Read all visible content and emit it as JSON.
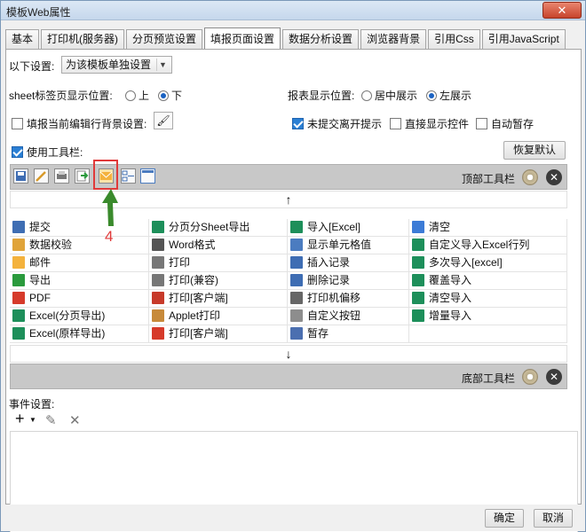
{
  "window": {
    "title": "模板Web属性",
    "close": "✕"
  },
  "tabs": [
    "基本",
    "打印机(服务器)",
    "分页预览设置",
    "填报页面设置",
    "数据分析设置",
    "浏览器背景",
    "引用Css",
    "引用JavaScript"
  ],
  "active_tab": "填报页面设置",
  "settings": {
    "apply_label": "以下设置:",
    "apply_value": "为该模板单独设置",
    "sheet_pos_label": "sheet标签页显示位置:",
    "sheet_pos_options": [
      "上",
      "下"
    ],
    "sheet_pos_selected": "下",
    "report_pos_label": "报表显示位置:",
    "report_pos_options": [
      "居中展示",
      "左展示"
    ],
    "report_pos_selected": "左展示",
    "fill_bg_label": "填报当前编辑行背景设置:",
    "unsubmitted_label": "未提交离开提示",
    "show_widget_label": "直接显示控件",
    "autosave_label": "自动暂存",
    "use_toolbar_label": "使用工具栏:",
    "restore_default": "恢复默认"
  },
  "top_toolbar": {
    "label": "顶部工具栏",
    "icons": [
      "save-icon",
      "validate-icon",
      "print-icon",
      "export-icon",
      "email-icon",
      "insert-record-icon",
      "blank-icon"
    ]
  },
  "bottom_toolbar": {
    "label": "底部工具栏"
  },
  "arrows": {
    "up": "↑",
    "down": "↓"
  },
  "callout": {
    "number": "4"
  },
  "buttons": [
    [
      {
        "label": "提交",
        "icon": "submit-icon"
      },
      {
        "label": "分页分Sheet导出",
        "icon": "excel-icon"
      },
      {
        "label": "导入[Excel]",
        "icon": "excel-import-icon"
      },
      {
        "label": "清空",
        "icon": "eraser-icon"
      }
    ],
    [
      {
        "label": "数据校验",
        "icon": "validate-icon"
      },
      {
        "label": "Word格式",
        "icon": "word-icon"
      },
      {
        "label": "显示单元格值",
        "icon": "cell-icon"
      },
      {
        "label": "自定义导入Excel行列",
        "icon": "excel-icon"
      }
    ],
    [
      {
        "label": "邮件",
        "icon": "email-icon"
      },
      {
        "label": "打印",
        "icon": "print-icon"
      },
      {
        "label": "插入记录",
        "icon": "insert-record-icon"
      },
      {
        "label": "多次导入[excel]",
        "icon": "excel-icon"
      }
    ],
    [
      {
        "label": "导出",
        "icon": "export-icon"
      },
      {
        "label": "打印(兼容)",
        "icon": "print-icon"
      },
      {
        "label": "删除记录",
        "icon": "delete-record-icon"
      },
      {
        "label": "覆盖导入",
        "icon": "excel-icon"
      }
    ],
    [
      {
        "label": "PDF",
        "icon": "pdf-icon"
      },
      {
        "label": "打印[客户端]",
        "icon": "flash-print-icon"
      },
      {
        "label": "打印机偏移",
        "icon": "move-icon"
      },
      {
        "label": "清空导入",
        "icon": "excel-icon"
      }
    ],
    [
      {
        "label": "Excel(分页导出)",
        "icon": "excel-icon"
      },
      {
        "label": "Applet打印",
        "icon": "applet-icon"
      },
      {
        "label": "自定义按钮",
        "icon": "gear-icon"
      },
      {
        "label": "增量导入",
        "icon": "excel-icon"
      }
    ],
    [
      {
        "label": "Excel(原样导出)",
        "icon": "excel-icon"
      },
      {
        "label": "打印[客户端]",
        "icon": "pdf-icon"
      },
      {
        "label": "暂存",
        "icon": "stash-icon"
      },
      {
        "label": "",
        "icon": ""
      }
    ]
  ],
  "event": {
    "label": "事件设置:",
    "add": "+",
    "edit": "✎",
    "remove": "✕"
  },
  "footer": {
    "ok": "确定",
    "cancel": "取消"
  }
}
